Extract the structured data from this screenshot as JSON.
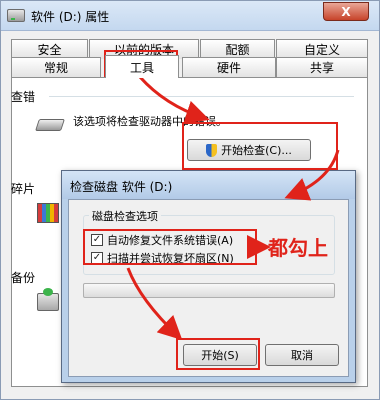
{
  "window": {
    "title": "软件 (D:) 属性",
    "close_label": "X"
  },
  "tabs": {
    "row_top": [
      "安全",
      "以前的版本",
      "配额",
      "自定义"
    ],
    "row_bottom": [
      "常规",
      "工具",
      "硬件",
      "共享"
    ],
    "active": "工具"
  },
  "error_check": {
    "title": "查错",
    "description": "该选项将检查驱动器中的错误。",
    "button_label": "开始检查(C)..."
  },
  "defrag": {
    "title": "碎片"
  },
  "backup": {
    "title": "备份"
  },
  "dialog": {
    "title": "检查磁盘 软件 (D:)",
    "options_legend": "磁盘检查选项",
    "option_fix": {
      "label": "自动修复文件系统错误(A)",
      "checked": true
    },
    "option_scan": {
      "label": "扫描并尝试恢复坏扇区(N)",
      "checked": true
    },
    "progress": 0,
    "start_label": "开始(S)",
    "cancel_label": "取消"
  },
  "annotation": {
    "text": "都勾上",
    "color": "#e0231a"
  },
  "colors": {
    "titlebar": "#c4d8ef",
    "close_button": "#c7432a",
    "annotation_red": "#e0231a"
  },
  "icons": [
    "drive-icon",
    "defrag-icon",
    "backup-icon",
    "shield-icon",
    "check-icon"
  ]
}
